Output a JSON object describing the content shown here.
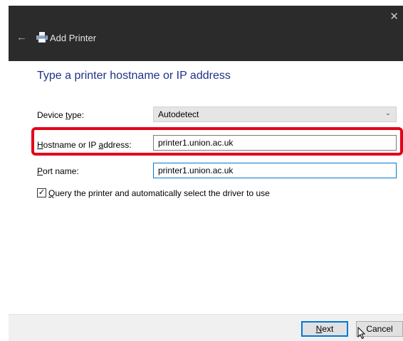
{
  "window": {
    "title": "Add Printer",
    "close_glyph": "✕",
    "back_glyph": "←"
  },
  "heading": "Type a printer hostname or IP address",
  "device_type": {
    "label_pre": "Device ",
    "label_key": "t",
    "label_post": "ype:",
    "value": "Autodetect",
    "chevron": "⌄"
  },
  "hostname": {
    "label_key": "H",
    "label_mid": "ostname or IP ",
    "label_key2": "a",
    "label_post": "ddress:",
    "value": "printer1.union.ac.uk"
  },
  "port": {
    "label_key": "P",
    "label_post": "ort name:",
    "value": "printer1.union.ac.uk"
  },
  "query_option": {
    "checked": true,
    "check_glyph": "✓",
    "label_key": "Q",
    "label_post": "uery the printer and automatically select the driver to use"
  },
  "buttons": {
    "next_key": "N",
    "next_post": "ext",
    "cancel": "Cancel"
  },
  "colors": {
    "title_bar": "#2b2b2b",
    "heading": "#1e3287",
    "highlight": "#e3001b",
    "focus_accent": "#0078d7"
  },
  "icons": [
    "close-icon",
    "back-arrow-icon",
    "printer-icon",
    "chevron-down-icon",
    "checkmark-icon",
    "mouse-cursor-icon"
  ]
}
